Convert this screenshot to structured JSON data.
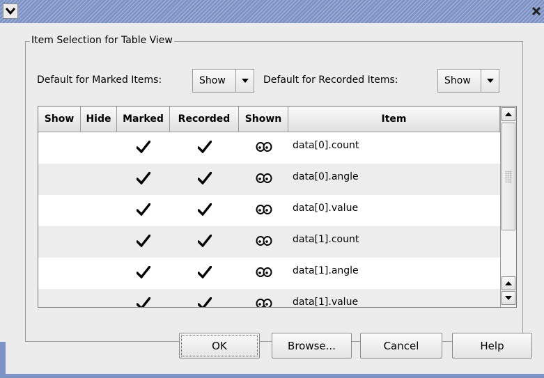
{
  "dialog": {
    "group_title": "Item Selection for Table View",
    "marked_label": "Default for Marked Items:",
    "marked_value": "Show",
    "recorded_label": "Default for Recorded Items:",
    "recorded_value": "Show"
  },
  "table": {
    "columns": [
      "Show",
      "Hide",
      "Marked",
      "Recorded",
      "Shown",
      "Item"
    ],
    "rows": [
      {
        "item": "data[0].count"
      },
      {
        "item": "data[0].angle"
      },
      {
        "item": "data[0].value"
      },
      {
        "item": "data[1].count"
      },
      {
        "item": "data[1].angle"
      },
      {
        "item": "data[1].value"
      }
    ]
  },
  "buttons": {
    "ok": "OK",
    "browse": "Browse...",
    "cancel": "Cancel",
    "help": "Help"
  },
  "icons": {
    "marked": "checkmark-icon",
    "recorded": "checkmark-icon",
    "shown": "eyes-icon"
  },
  "colors": {
    "titlebar": "#7d92c5",
    "dialog_bg": "#ececec",
    "row_alt": "#ededed"
  }
}
